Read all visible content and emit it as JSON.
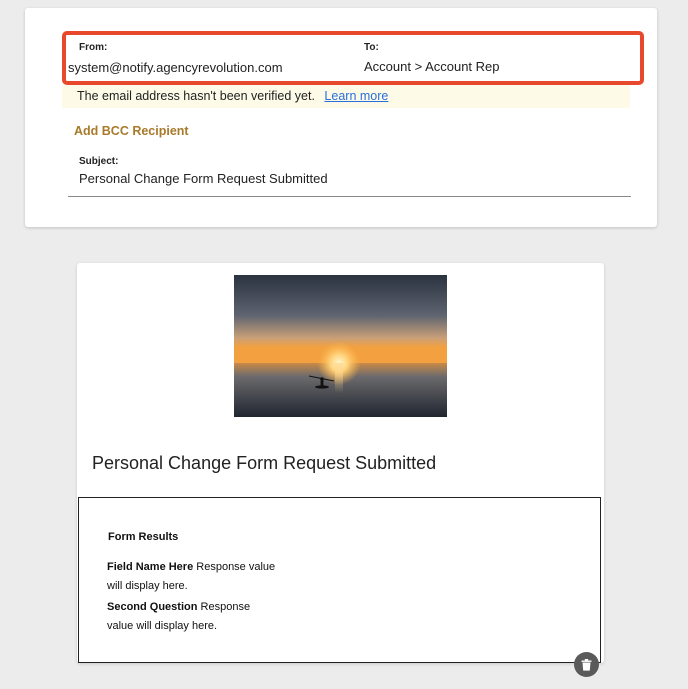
{
  "header": {
    "from_label": "From:",
    "from_value": "system@notify.agencyrevolution.com",
    "to_label": "To:",
    "to_value": "Account > Account Rep",
    "verify_message": "The email address hasn't been verified yet.",
    "learn_more_label": "Learn more",
    "add_bcc_label": "Add BCC Recipient",
    "subject_label": "Subject:",
    "subject_value": "Personal Change Form Request Submitted"
  },
  "email_body": {
    "title": "Personal Change Form Request Submitted",
    "form_results": {
      "title": "Form Results",
      "fields": [
        {
          "name": "Field Name Here",
          "value": "Response value will display here."
        },
        {
          "name": "Second Question",
          "value": "Response value will display here."
        }
      ]
    }
  },
  "colors": {
    "highlight_border": "#e8482c",
    "link": "#2a6fdb",
    "bcc_link": "#a87a2a",
    "verify_bg": "#fdfbe8"
  },
  "icons": {
    "delete": "trash-icon"
  }
}
